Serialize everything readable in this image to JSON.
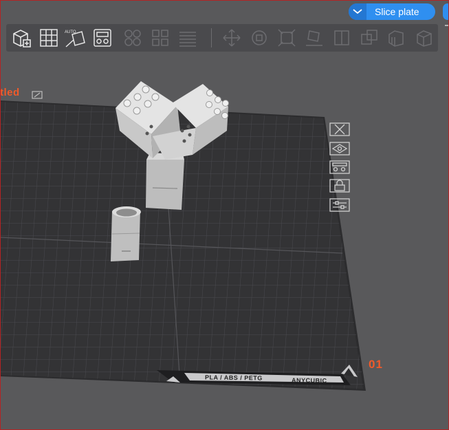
{
  "slice_button": {
    "label": "Slice plate"
  },
  "plate": {
    "name": "tled",
    "number": "01"
  },
  "bed_strip": {
    "material": "PLA / ABS / PETG",
    "brand": "ANYCUBIC"
  },
  "toolbar": {
    "tools": [
      "add-object-icon",
      "arrange-grid-icon",
      "auto-orient-icon",
      "plate-layout-icon",
      "split-objects-icon",
      "split-parts-icon",
      "layers-icon",
      "move-icon",
      "rotate-icon",
      "scale-icon",
      "lay-on-face-icon",
      "cut-icon",
      "boolean-icon",
      "support-paint-icon",
      "seam-paint-icon"
    ]
  },
  "side_tools": [
    "close-view-icon",
    "view-eye-icon",
    "plate-settings-icon",
    "lock-icon",
    "sliders-icon"
  ],
  "colors": {
    "accent": "#f05a2a",
    "slice_blue": "#2f8ff0",
    "bed": "#333335",
    "background": "#59595b"
  }
}
